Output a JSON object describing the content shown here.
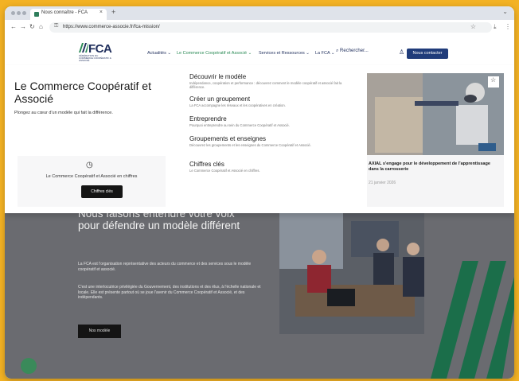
{
  "browser": {
    "tab_title": "Nous connaître - FCA",
    "tab_close": "×",
    "new_tab": "+",
    "window_control": "⌄",
    "url": "https://www.commerce-associe.fr/fca-mission/"
  },
  "header": {
    "logo_text": "FCA",
    "logo_tagline": "FÉDÉRATION DU COMMERCE COOPÉRATIF & ASSOCIÉ",
    "menu": [
      {
        "label": "Actualités ⌄"
      },
      {
        "label": "Le Commerce Coopératif et Associé ⌄"
      },
      {
        "label": "Services et Ressources ⌄"
      },
      {
        "label": "La FCA ⌄"
      }
    ],
    "search_label": "Rechercher...",
    "contact_label": "Nous contacter"
  },
  "mega_menu": {
    "title": "Le Commerce Coopératif et Associé",
    "subtitle": "Plongez au cœur d'un modèle qui fait la différence.",
    "card": {
      "text": "Le Commerce Coopératif et Associé en chiffres",
      "button": "Chiffres clés"
    },
    "links": [
      {
        "title": "Découvrir le modèle",
        "desc": "Indépendance, coopération et performance : découvrez comment le modèle coopératif et associé fait la différence."
      },
      {
        "title": "Créer un groupement",
        "desc": "La FCA accompagne les réseaux et les coopératives en création."
      },
      {
        "title": "Entreprendre",
        "desc": "Pourquoi entreprendre au sein du Commerce Coopératif et Associé."
      },
      {
        "title": "Groupements et enseignes",
        "desc": "Découvrez les groupements et les enseignes du Commerce Coopératif et Associé."
      },
      {
        "title": "Chiffres clés",
        "desc": "Le Commerce Coopératif et Associé en chiffres."
      }
    ],
    "news": {
      "title": "AXIAL s'engage pour le développement de l'apprentissage dans la carrosserie",
      "date": "21 janvier 2026"
    }
  },
  "hero": {
    "title": "Nous faisons entendre votre voix pour défendre un modèle différent",
    "paragraph1": "La FCA est l'organisation représentative des acteurs du commerce et des services sous le modèle coopératif et associé.",
    "paragraph2": "C'est une interlocutrice privilégiée du Gouvernement, des institutions et des élus, à l'échelle nationale et locale. Elle est présente partout où se joue l'avenir du Commerce Coopératif et Associé, et des indépendants.",
    "button": "Nos modèle"
  },
  "colors": {
    "brand_navy": "#1f2e5c",
    "accent_green": "#2a8a55",
    "contact_button": "#203c7a",
    "outer_background": "#f3b224"
  }
}
